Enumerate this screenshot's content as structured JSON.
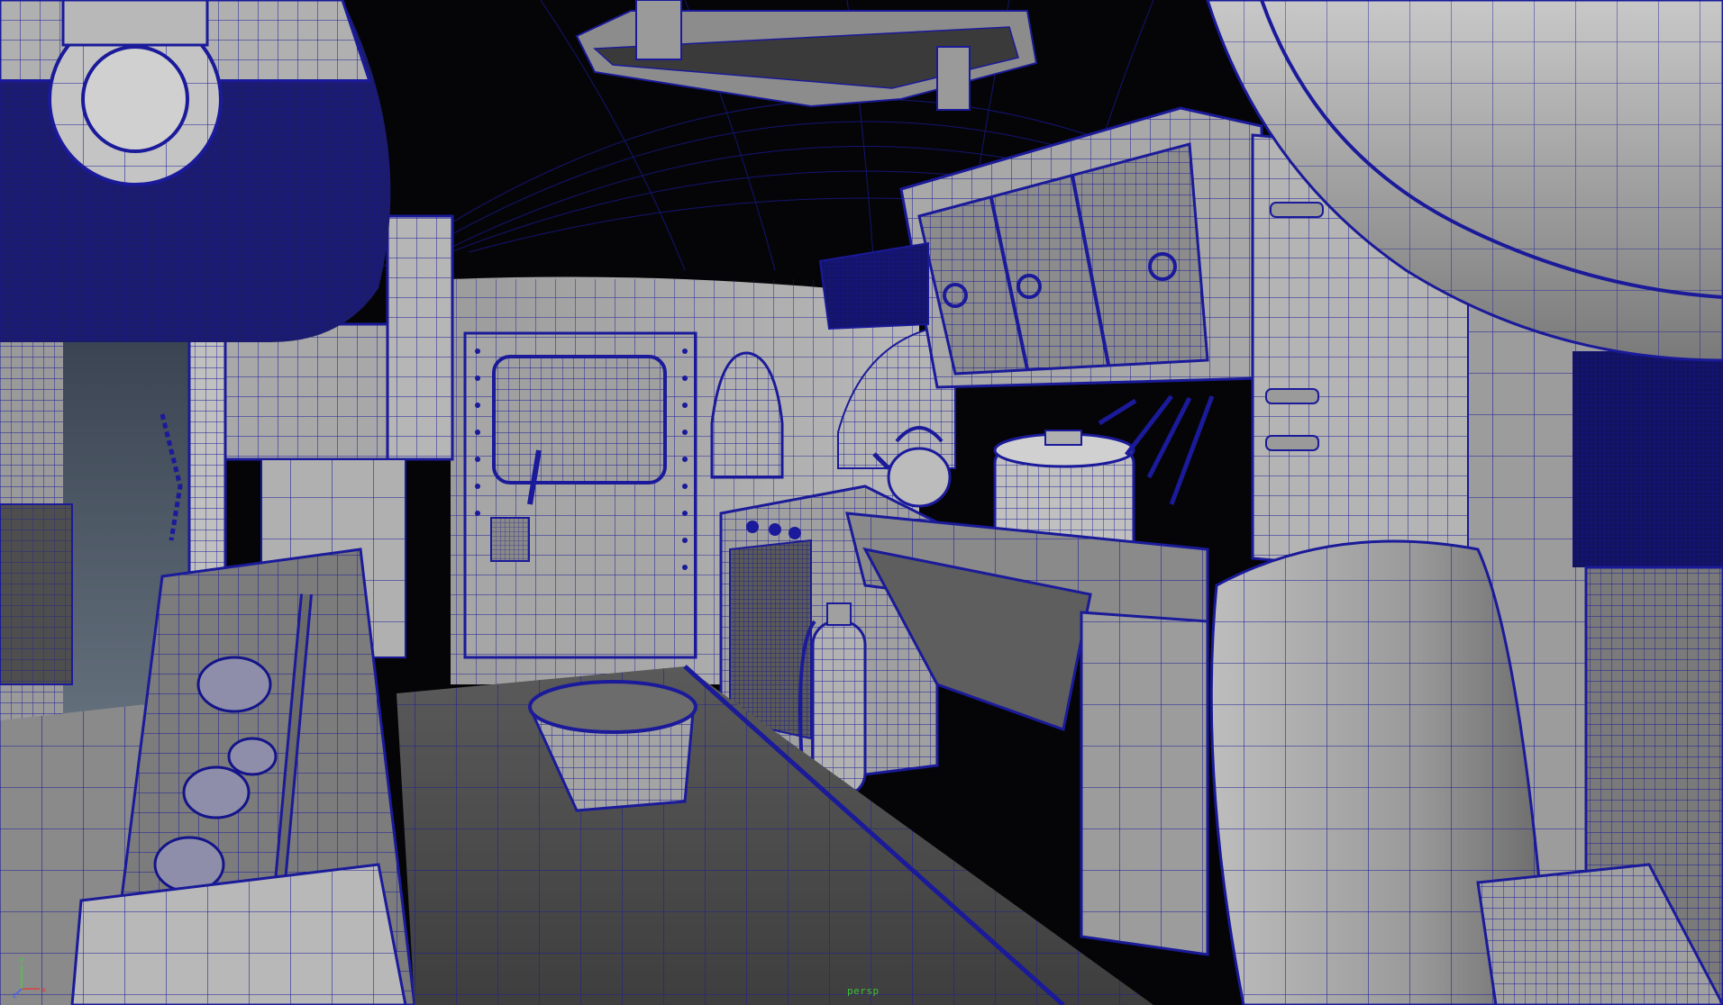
{
  "viewport": {
    "camera_name": "persp",
    "shading_mode": "wireframe-on-shaded",
    "wire_color": "#1a1a9a",
    "surface_color": "#a8a8a8",
    "background_color": "#050508"
  },
  "axis_gizmo": {
    "x_label": "x",
    "y_label": "Y",
    "z_label": "z",
    "x_color": "#e04040",
    "y_color": "#40d040",
    "z_color": "#4060ff"
  }
}
